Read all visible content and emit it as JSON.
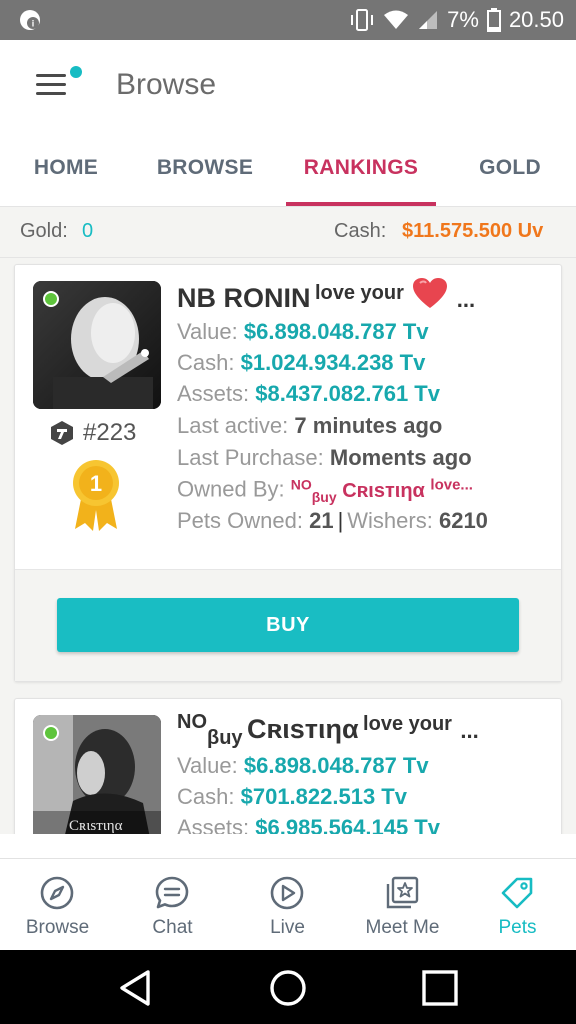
{
  "status_bar": {
    "battery": "7%",
    "time": "20.50"
  },
  "app_bar": {
    "title": "Browse"
  },
  "tabs": [
    {
      "label": "HOME",
      "active": false
    },
    {
      "label": "BROWSE",
      "active": false
    },
    {
      "label": "RANKINGS",
      "active": true
    },
    {
      "label": "GOLD",
      "active": false
    }
  ],
  "balance": {
    "gold_label": "Gold:",
    "gold_value": "0",
    "cash_label": "Cash:",
    "cash_value": "$11.575.500 Uv"
  },
  "pets": [
    {
      "name": "NB RONIN",
      "name_suffix": "love your",
      "ellipsis": "...",
      "rank": "#223",
      "medal_number": "1",
      "value_label": "Value:",
      "value": "$6.898.048.787 Tv",
      "cash_label": "Cash:",
      "cash": "$1.024.934.238 Tv",
      "assets_label": "Assets:",
      "assets": "$8.437.082.761 Tv",
      "last_active_label": "Last active:",
      "last_active": "7 minutes ago",
      "last_purchase_label": "Last Purchase:",
      "last_purchase": "Moments ago",
      "owned_by_label": "Owned By:",
      "owned_by_sup": "NO",
      "owned_by_sub": "βuу",
      "owned_by_name": "Cʀιѕтιηα",
      "owned_by_suffix": "love...",
      "pets_owned_label": "Pets Owned:",
      "pets_owned": "21",
      "separator": "|",
      "wishers_label": "Wishers:",
      "wishers": "6210",
      "buy_label": "BUY"
    },
    {
      "name_sup": "NO",
      "name_sub": "βuу",
      "name": "Cʀιѕтιηα",
      "name_suffix": "love your",
      "ellipsis": "...",
      "photo_caption": "Cʀιѕтιηα",
      "value_label": "Value:",
      "value": "$6.898.048.787 Tv",
      "cash_label": "Cash:",
      "cash": "$701.822.513 Tv",
      "assets_label": "Assets:",
      "assets": "$6.985.564.145 Tv"
    }
  ],
  "bottom_nav": [
    {
      "label": "Browse",
      "icon": "compass-icon",
      "active": false
    },
    {
      "label": "Chat",
      "icon": "chat-bubble-icon",
      "active": false
    },
    {
      "label": "Live",
      "icon": "play-icon",
      "active": false
    },
    {
      "label": "Meet Me",
      "icon": "star-cards-icon",
      "active": false
    },
    {
      "label": "Pets",
      "icon": "tag-icon",
      "active": true
    }
  ],
  "colors": {
    "accent": "#17bcc3",
    "active_tab": "#c8325f",
    "cash": "#f0771c"
  }
}
